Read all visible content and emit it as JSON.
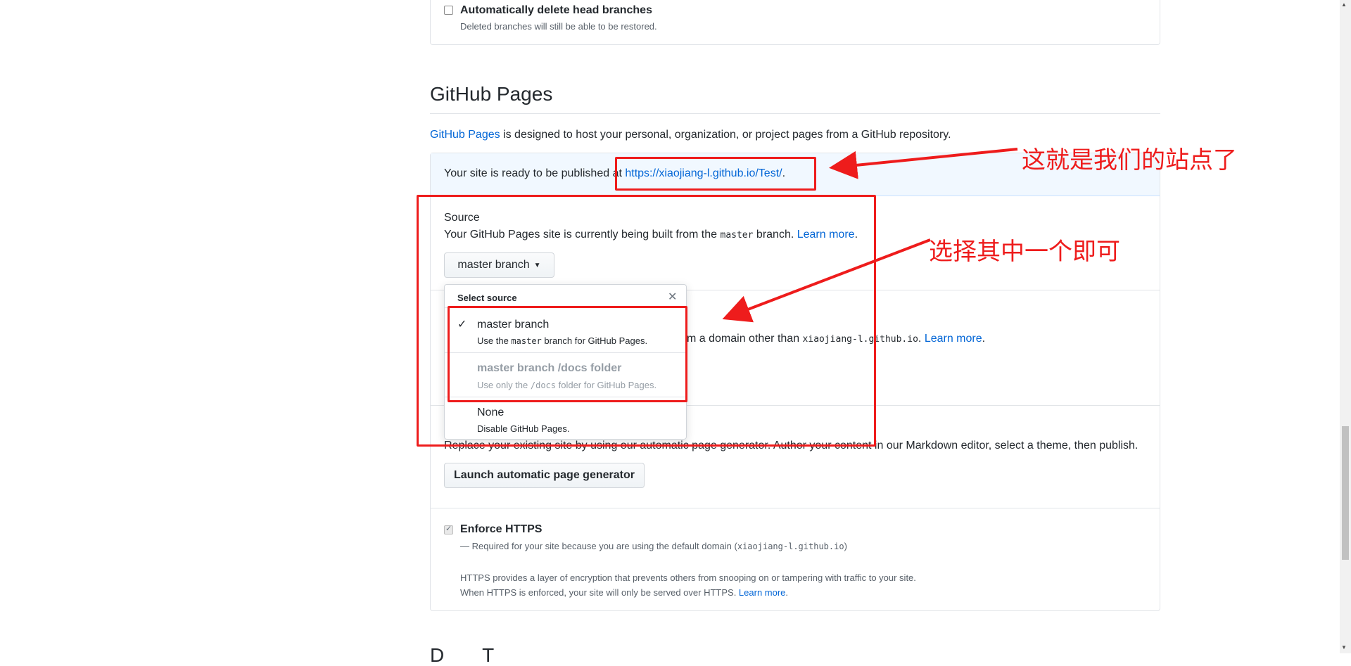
{
  "merge_options": {
    "auto_delete_label": "Automatically delete head branches",
    "auto_delete_note": "Deleted branches will still be able to be restored."
  },
  "github_pages": {
    "title": "GitHub Pages",
    "intro_link": "GitHub Pages",
    "intro_rest": " is designed to host your personal, organization, or project pages from a GitHub repository.",
    "flash_prefix": "Your site is ready to be published at ",
    "flash_url": "https://xiaojiang-l.github.io/Test/",
    "flash_suffix": ".",
    "source": {
      "heading": "Source",
      "desc_prefix": "Your GitHub Pages site is currently being built from the ",
      "desc_code": "master",
      "desc_suffix": " branch. ",
      "learn_more": "Learn more",
      "learn_more_dot": ".",
      "button_label": "master branch"
    },
    "custom_domain": {
      "desc_fragment": "m a domain other than ",
      "desc_code": "xiaojiang-l.github.io",
      "desc_dot": ". ",
      "learn_more": "Learn more",
      "learn_more_dot": "."
    },
    "dropdown": {
      "header": "Select source",
      "items": [
        {
          "title": "master branch",
          "desc_prefix": "Use the ",
          "desc_code": "master",
          "desc_suffix": " branch for GitHub Pages.",
          "selected": true,
          "disabled": false
        },
        {
          "title": "master branch /docs folder",
          "desc_prefix": "Use only the ",
          "desc_code": "/docs",
          "desc_suffix": " folder for GitHub Pages.",
          "selected": false,
          "disabled": true
        },
        {
          "title": "None",
          "desc_prefix": "Disable GitHub Pages.",
          "desc_code": "",
          "desc_suffix": "",
          "selected": false,
          "disabled": false
        }
      ]
    },
    "theme": {
      "desc": "Replace your existing site by using our automatic page generator. Author your content in our Markdown editor, select a theme, then publish.",
      "button_label": "Launch automatic page generator"
    },
    "https": {
      "label": "Enforce HTTPS",
      "required_prefix": "— Required for your site because you are using the default domain (",
      "required_code": "xiaojiang-l.github.io",
      "required_suffix": ")",
      "info_line1": "HTTPS provides a layer of encryption that prevents others from snooping on or tampering with traffic to your site.",
      "info_line2": "When HTTPS is enforced, your site will only be served over HTTPS. ",
      "learn_more": "Learn more",
      "learn_more_dot": "."
    },
    "next_section_fragment": "D       T"
  },
  "annotations": {
    "site_note": "这就是我们的站点了",
    "choose_note": "选择其中一个即可",
    "color": "#ee1c1c"
  }
}
